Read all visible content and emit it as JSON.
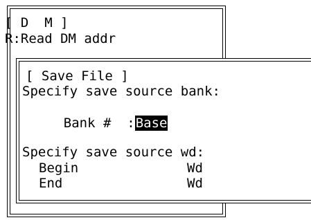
{
  "dm_window": {
    "title": "[ D  M ]",
    "subtitle": "R:Read DM addr"
  },
  "save_dialog": {
    "title": "[ Save File ]",
    "bank_prompt": "Specify save source bank:",
    "bank_label": "Bank #  :",
    "bank_value": "Base",
    "wd_prompt": "Specify save source wd:",
    "begin_label": "Begin",
    "begin_unit": "Wd",
    "end_label": "End",
    "end_unit": "Wd"
  }
}
